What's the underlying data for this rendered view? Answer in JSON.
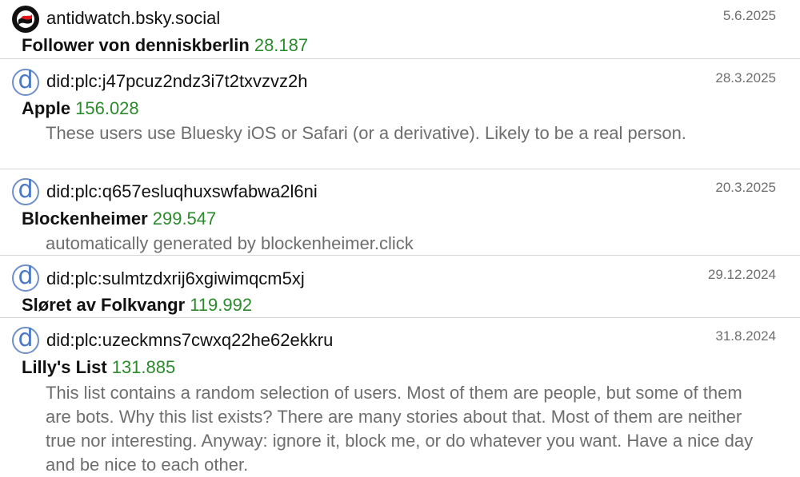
{
  "items": [
    {
      "handle": "antidwatch.bsky.social",
      "date": "5.6.2025",
      "title": "Follower von denniskberlin",
      "count": "28.187",
      "description": "",
      "avatar": "antifa-flag-icon"
    },
    {
      "handle": "did:plc:j47pcuz2ndz3i7t2txvzvz2h",
      "date": "28.3.2025",
      "title": "Apple",
      "count": "156.028",
      "description": "These users use Bluesky iOS or Safari (or a derivative). Likely to be a real person.",
      "avatar": "did-placeholder-icon",
      "avatar_letter": "d"
    },
    {
      "handle": "did:plc:q657esluqhuxswfabwa2l6ni",
      "date": "20.3.2025",
      "title": "Blockenheimer",
      "count": "299.547",
      "description": "automatically generated by blockenheimer.click",
      "avatar": "did-placeholder-icon",
      "avatar_letter": "d"
    },
    {
      "handle": "did:plc:sulmtzdxrij6xgiwimqcm5xj",
      "date": "29.12.2024",
      "title": "Sløret av Folkvangr",
      "count": "119.992",
      "description": "",
      "avatar": "did-placeholder-icon",
      "avatar_letter": "d"
    },
    {
      "handle": "did:plc:uzeckmns7cwxq22he62ekkru",
      "date": "31.8.2024",
      "title": "Lilly's List",
      "count": "131.885",
      "description": "This list contains a random selection of users. Most of them are people, but some of them are bots. Why this list exists? There are many stories about that. Most of them are neither true nor interesting. Anyway: ignore it, block me, or do whatever you want. Have a nice day and be nice to each other.",
      "avatar": "did-placeholder-icon",
      "avatar_letter": "d"
    }
  ],
  "colors": {
    "count": "#2b8a2b",
    "muted": "#6e6e6e",
    "divider": "#d6d6d6",
    "did_avatar": "#4a78c6",
    "antifa_red": "#e3171b"
  }
}
